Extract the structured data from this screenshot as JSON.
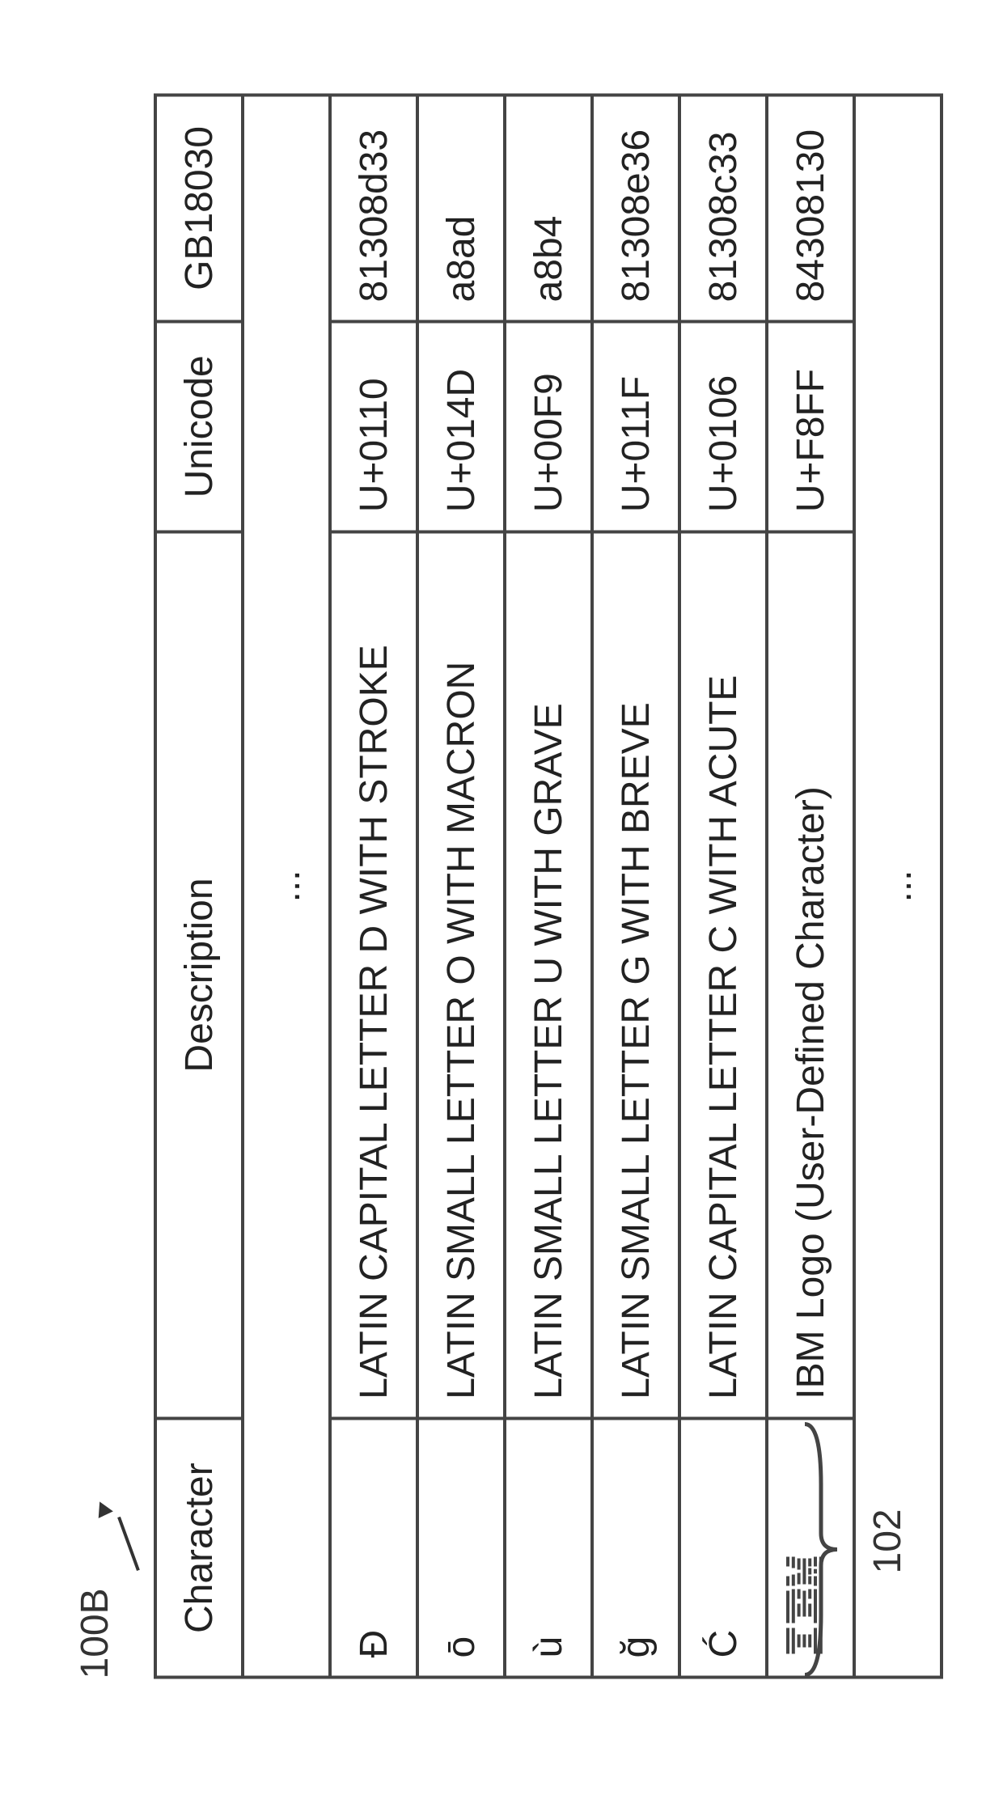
{
  "figure_label": "100B",
  "callout_label": "102",
  "table": {
    "headers": {
      "character": "Character",
      "description": "Description",
      "unicode": "Unicode",
      "gb18030": "GB18030"
    },
    "ellipsis": "...",
    "rows": [
      {
        "character": "Đ",
        "description": "LATIN CAPITAL LETTER D WITH STROKE",
        "unicode": "U+0110",
        "gb18030": "81308d33"
      },
      {
        "character": "ō",
        "description": "LATIN SMALL LETTER O WITH MACRON",
        "unicode": "U+014D",
        "gb18030": "a8ad"
      },
      {
        "character": "ù",
        "description": "LATIN SMALL LETTER U WITH GRAVE",
        "unicode": "U+00F9",
        "gb18030": "a8b4"
      },
      {
        "character": "ğ",
        "description": "LATIN SMALL LETTER G WITH BREVE",
        "unicode": "U+011F",
        "gb18030": "81308e36"
      },
      {
        "character": "Ć",
        "description": "LATIN CAPITAL LETTER C WITH ACUTE",
        "unicode": "U+0106",
        "gb18030": "81308c33"
      },
      {
        "character": "__IBM_LOGO__",
        "description": "IBM Logo (User-Defined Character)",
        "unicode": "U+F8FF",
        "gb18030": "84308130"
      }
    ]
  }
}
